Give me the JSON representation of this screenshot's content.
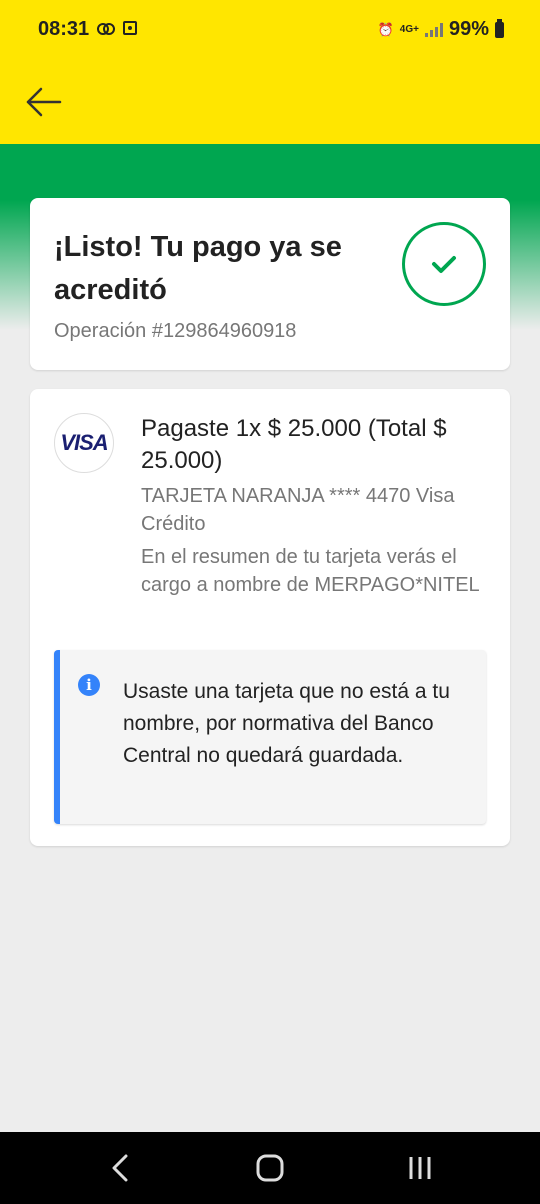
{
  "status_bar": {
    "time": "08:31",
    "network": "4G+",
    "battery": "99%"
  },
  "header": {
    "back_icon": "arrow-left-icon",
    "color": "#ffe600"
  },
  "success_card": {
    "title": "¡Listo! Tu pago ya se acreditó",
    "operation": "Operación #129864960918",
    "status_icon": "check-circle-icon",
    "accent_color": "#00a650"
  },
  "payment_card": {
    "brand": "VISA",
    "summary": "Pagaste 1x $ 25.000 (Total $ 25.000)",
    "card_info": "TARJETA NARANJA **** 4470 Visa Crédito",
    "statement_note": "En el resumen de tu tarjeta verás el cargo a nombre de MERPAGO*NITEL",
    "notice": {
      "icon": "info-icon",
      "text": "Usaste una tarjeta que no está a tu nombre, por normativa del Banco Central no quedará guardada.",
      "accent_color": "#3483fa"
    }
  },
  "nav_bar": {
    "back_icon": "nav-back-icon",
    "home_icon": "nav-home-icon",
    "recents_icon": "nav-recents-icon"
  }
}
